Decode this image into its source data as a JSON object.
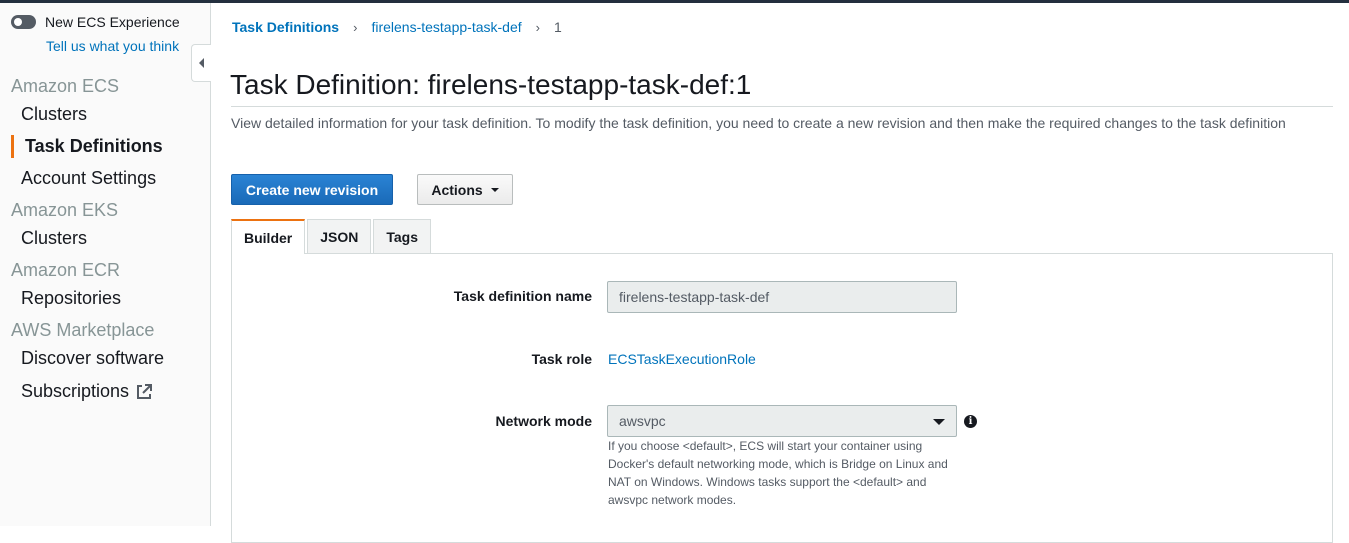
{
  "sidebar": {
    "toggle_label": "New ECS Experience",
    "feedback_link": "Tell us what you think",
    "sections": [
      {
        "title": "Amazon ECS",
        "items": [
          "Clusters",
          "Task Definitions",
          "Account Settings"
        ]
      },
      {
        "title": "Amazon EKS",
        "items": [
          "Clusters"
        ]
      },
      {
        "title": "Amazon ECR",
        "items": [
          "Repositories"
        ]
      },
      {
        "title": "AWS Marketplace",
        "items": [
          "Discover software",
          "Subscriptions"
        ]
      }
    ],
    "active_item": "Task Definitions",
    "accent_color": "#ec7211"
  },
  "breadcrumb": {
    "items": [
      "Task Definitions",
      "firelens-testapp-task-def"
    ],
    "current": "1",
    "separator": "›"
  },
  "page": {
    "title": "Task Definition: firelens-testapp-task-def:1",
    "description": "View detailed information for your task definition. To modify the task definition, you need to create a new revision and then make the required changes to the task definition"
  },
  "buttons": {
    "create_revision": "Create new revision",
    "actions": "Actions"
  },
  "tabs": [
    "Builder",
    "JSON",
    "Tags"
  ],
  "active_tab": "Builder",
  "form": {
    "task_def_name_label": "Task definition name",
    "task_def_name_value": "firelens-testapp-task-def",
    "task_role_label": "Task role",
    "task_role_value": "ECSTaskExecutionRole",
    "network_mode_label": "Network mode",
    "network_mode_value": "awsvpc",
    "network_mode_help": "If you choose <default>, ECS will start your container using Docker's default networking mode, which is Bridge on Linux and NAT on Windows. Windows tasks support the <default> and awsvpc network modes.",
    "info_icon": "i"
  },
  "colors": {
    "link": "#0073bb",
    "primary_button": "#1a6ab8",
    "header": "#232f3e"
  }
}
